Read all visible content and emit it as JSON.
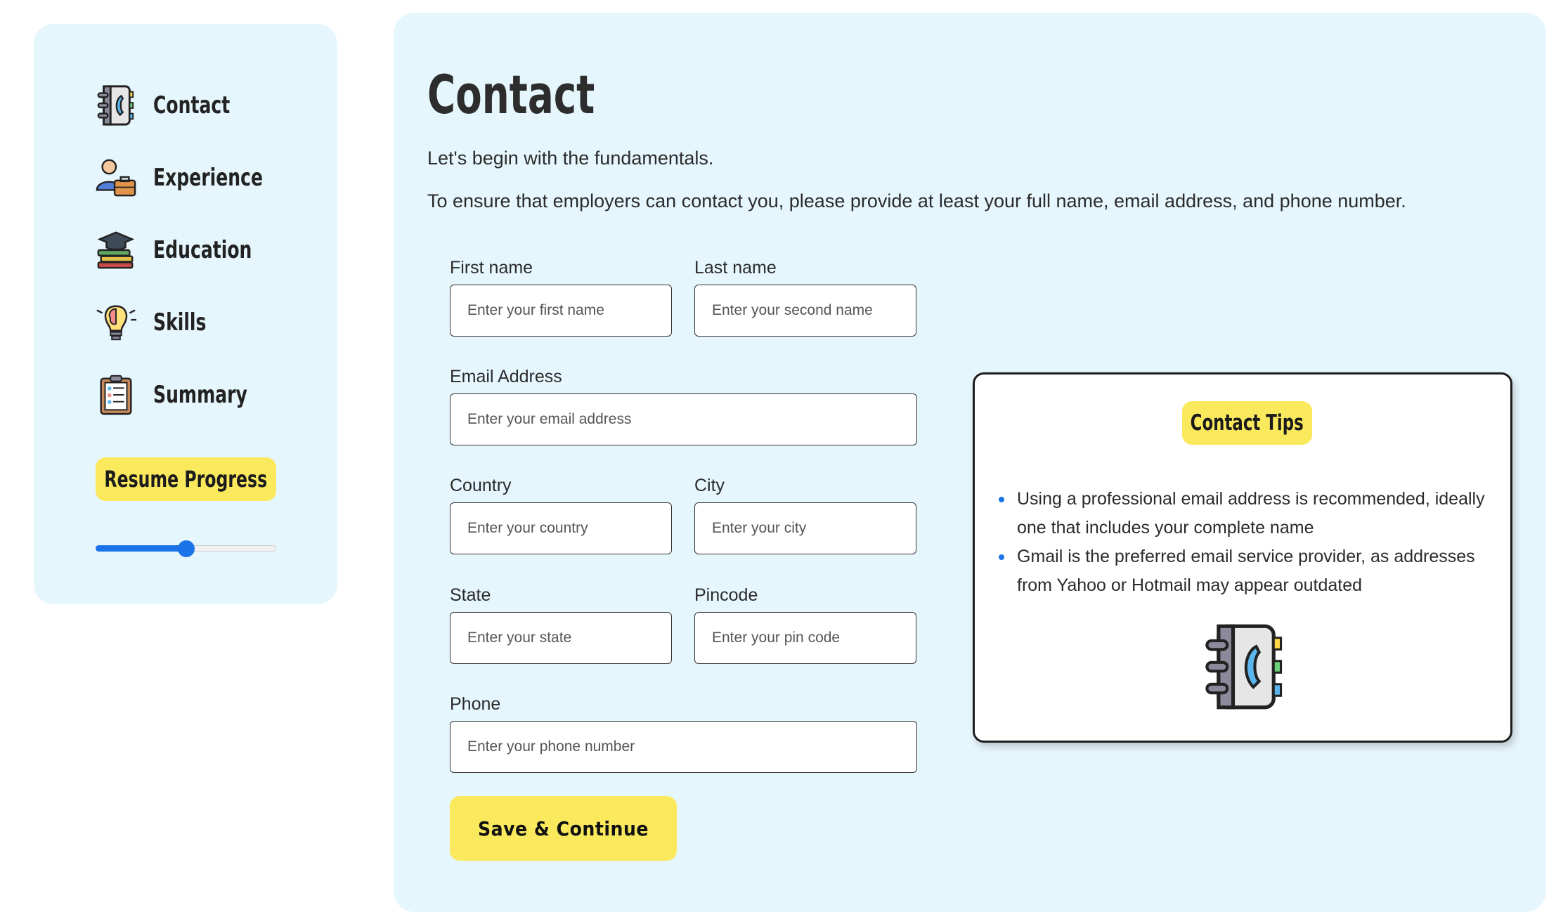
{
  "sidebar": {
    "items": [
      {
        "label": "Contact",
        "icon": "address-book-icon"
      },
      {
        "label": "Experience",
        "icon": "worker-briefcase-icon"
      },
      {
        "label": "Education",
        "icon": "graduation-books-icon"
      },
      {
        "label": "Skills",
        "icon": "brain-bulb-icon"
      },
      {
        "label": "Summary",
        "icon": "clipboard-icon"
      }
    ],
    "progress_label": "Resume Progress",
    "progress_value": 0.5
  },
  "main": {
    "title": "Contact",
    "intro_line1": "Let's begin with the fundamentals.",
    "intro_line2": "To ensure that employers can contact you, please provide at least your full name, email address, and phone number.",
    "fields": {
      "first_name": {
        "label": "First name",
        "placeholder": "Enter your first name",
        "value": ""
      },
      "last_name": {
        "label": "Last name",
        "placeholder": "Enter your second name",
        "value": ""
      },
      "email": {
        "label": "Email Address",
        "placeholder": "Enter your email address",
        "value": ""
      },
      "country": {
        "label": "Country",
        "placeholder": "Enter your country",
        "value": ""
      },
      "city": {
        "label": "City",
        "placeholder": "Enter your city",
        "value": ""
      },
      "state": {
        "label": "State",
        "placeholder": "Enter your state",
        "value": ""
      },
      "pincode": {
        "label": "Pincode",
        "placeholder": "Enter your pin code",
        "value": ""
      },
      "phone": {
        "label": "Phone",
        "placeholder": "Enter your phone number",
        "value": ""
      }
    },
    "save_label": "Save & Continue"
  },
  "tips": {
    "title": "Contact Tips",
    "items": [
      "Using a professional email address is recommended, ideally one that includes your complete name",
      "Gmail is the preferred email service provider, as addresses from Yahoo or Hotmail may appear outdated"
    ],
    "icon": "address-book-icon"
  },
  "colors": {
    "panel_bg": "#e6f6fd",
    "accent_yellow": "#fbe95d",
    "slider_blue": "#1a73e8"
  }
}
